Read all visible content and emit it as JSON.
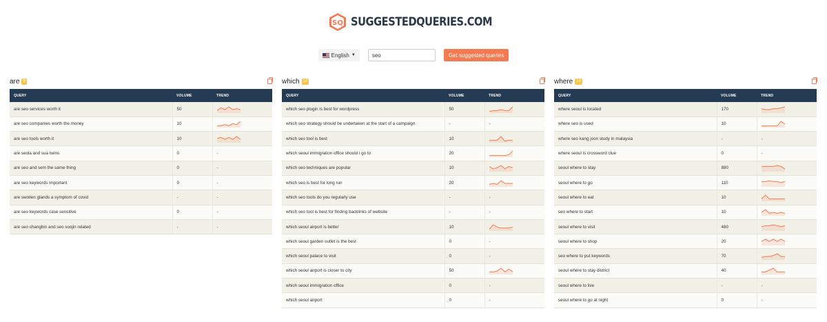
{
  "brand": {
    "name": "SUGGESTEDQUERIES.COM",
    "logo_icon": "hexagon-sq-logo",
    "accent": "#f47a52",
    "header_bg": "#253a53",
    "badge": "#f8c44a"
  },
  "search": {
    "language": "English",
    "language_icon": "us-flag-icon",
    "query": "seo",
    "placeholder": "",
    "button": "Get suggested queries"
  },
  "headers": {
    "query": "QUERY",
    "volume": "VOLUME",
    "trend": "TREND"
  },
  "columns": [
    {
      "title": "are",
      "count": "9",
      "rows": [
        {
          "query": "are seo services worth it",
          "volume": "50",
          "trend": [
            2,
            5,
            3,
            6,
            3,
            4,
            3
          ]
        },
        {
          "query": "are seo companies worth the money",
          "volume": "10",
          "trend": [
            1,
            1,
            2,
            1,
            3,
            2,
            5
          ]
        },
        {
          "query": "are seo tools worth it",
          "volume": "10",
          "trend": [
            4,
            5,
            3,
            5,
            3,
            6,
            3
          ]
        },
        {
          "query": "are seola and sua twins",
          "volume": "0",
          "trend": null
        },
        {
          "query": "are seo and sem the same thing",
          "volume": "0",
          "trend": null
        },
        {
          "query": "are seo keywords important",
          "volume": "0",
          "trend": null
        },
        {
          "query": "are swollen glands a symptom of covid",
          "volume": "-",
          "trend": null
        },
        {
          "query": "are seo keywords case sensitive",
          "volume": "0",
          "trend": null
        },
        {
          "query": "are seo changbin and seo soojin related",
          "volume": "-",
          "trend": null
        }
      ]
    },
    {
      "title": "which",
      "count": "14",
      "rows": [
        {
          "query": "which seo plugin is best for wordpress",
          "volume": "50",
          "trend": [
            1,
            2,
            2,
            3,
            2,
            2,
            6
          ]
        },
        {
          "query": "which seo strategy should be undertaken at the start of a campaign",
          "volume": "-",
          "trend": null
        },
        {
          "query": "which seo tool is best",
          "volume": "10",
          "trend": [
            2,
            2,
            2,
            6,
            1,
            2,
            2
          ]
        },
        {
          "query": "which seoul immigration office should i go to",
          "volume": "20",
          "trend": [
            1,
            1,
            1,
            1,
            1,
            2,
            6
          ]
        },
        {
          "query": "which seo techniques are popular",
          "volume": "10",
          "trend": [
            4,
            2,
            3,
            5,
            2,
            4,
            3
          ]
        },
        {
          "query": "which seo is best for long run",
          "volume": "20",
          "trend": [
            2,
            3,
            2,
            6,
            3,
            3,
            3
          ]
        },
        {
          "query": "which seo tools do you regularly use",
          "volume": "-",
          "trend": null
        },
        {
          "query": "which seo tool is best for finding backlinks of website",
          "volume": "-",
          "trend": null
        },
        {
          "query": "which seoul airport is better",
          "volume": "10",
          "trend": [
            1,
            5,
            3,
            2,
            2,
            2,
            3
          ]
        },
        {
          "query": "which seoul garden outlet is the best",
          "volume": "0",
          "trend": null
        },
        {
          "query": "which seoul palace to visit",
          "volume": "0",
          "trend": null
        },
        {
          "query": "which seoul airport is closer to city",
          "volume": "50",
          "trend": [
            2,
            2,
            3,
            6,
            2,
            5,
            2
          ]
        },
        {
          "query": "which seoul immigration office",
          "volume": "0",
          "trend": null
        },
        {
          "query": "which seoul airport",
          "volume": "0",
          "trend": null
        }
      ]
    },
    {
      "title": "where",
      "count": "14",
      "rows": [
        {
          "query": "where seoul is located",
          "volume": "170",
          "trend": [
            4,
            3,
            3,
            4,
            4,
            5,
            6
          ]
        },
        {
          "query": "where seo is used",
          "volume": "10",
          "trend": [
            1,
            1,
            1,
            1,
            1,
            6,
            3
          ]
        },
        {
          "query": "where seo kang joon study in malaysia",
          "volume": "-",
          "trend": null
        },
        {
          "query": "where seoul is crossword clue",
          "volume": "0",
          "trend": null
        },
        {
          "query": "seoul where to stay",
          "volume": "880",
          "trend": [
            5,
            5,
            5,
            5,
            6,
            5,
            2
          ]
        },
        {
          "query": "seoul where to go",
          "volume": "110",
          "trend": [
            5,
            5,
            6,
            5,
            5,
            4,
            5
          ]
        },
        {
          "query": "seoul where to eat",
          "volume": "10",
          "trend": [
            2,
            6,
            2,
            2,
            2,
            2,
            2
          ]
        },
        {
          "query": "seo where to start",
          "volume": "10",
          "trend": [
            3,
            6,
            2,
            3,
            2,
            3,
            2
          ]
        },
        {
          "query": "seoul where to visit",
          "volume": "480",
          "trend": [
            4,
            5,
            5,
            6,
            5,
            4,
            5
          ]
        },
        {
          "query": "seoul where to shop",
          "volume": "20",
          "trend": [
            3,
            5,
            3,
            5,
            3,
            5,
            3
          ]
        },
        {
          "query": "seo where to put keywords",
          "volume": "70",
          "trend": [
            2,
            3,
            3,
            4,
            6,
            3,
            3
          ]
        },
        {
          "query": "seoul where to stay district",
          "volume": "40",
          "trend": [
            2,
            2,
            4,
            6,
            2,
            2,
            2
          ]
        },
        {
          "query": "seoul where to live",
          "volume": "-",
          "trend": null
        },
        {
          "query": "seoul where to go at night",
          "volume": "0",
          "trend": null
        }
      ]
    }
  ],
  "empty_trend": "-"
}
